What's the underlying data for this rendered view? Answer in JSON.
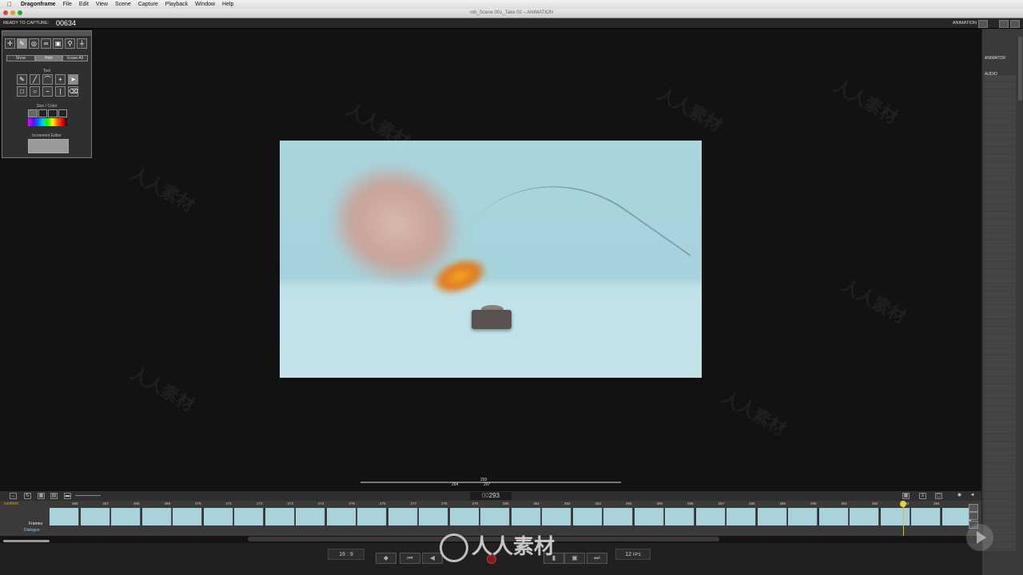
{
  "menubar": {
    "apple": "",
    "app": "Dragonframe",
    "items": [
      "File",
      "Edit",
      "View",
      "Scene",
      "Capture",
      "Playback",
      "Window",
      "Help"
    ]
  },
  "window": {
    "title": "rob_Scene 001_Take 02 – ANIMATION"
  },
  "status": {
    "ready_label": "READY TO CAPTURE:",
    "frame_number": "00634",
    "mode": "ANIMATION"
  },
  "right_panel": {
    "animator": "ANIMATOR",
    "audio": "AUDIO"
  },
  "tool_palette": {
    "segments": [
      "Show",
      "Hide",
      "Erase All"
    ],
    "tool_label": "Tool",
    "size_color_label": "Size / Color",
    "increment_label": "Increment Editor"
  },
  "scrubber": {
    "current": "293",
    "in_point": "264",
    "out_point": "297"
  },
  "timeline": {
    "frame_counter_prefix": "00",
    "frame_counter": "293",
    "conform_label": "conform",
    "tracks": [
      "Frames",
      "Dialogue"
    ],
    "ruler": [
      "266",
      "267",
      "268",
      "269",
      "270",
      "271",
      "272",
      "273",
      "274",
      "275",
      "276",
      "277",
      "278",
      "279",
      "280",
      "281",
      "282",
      "283",
      "284",
      "285",
      "286",
      "287",
      "288",
      "289",
      "290",
      "291",
      "292",
      "293",
      "294"
    ]
  },
  "transport": {
    "aspect": "16 : 9",
    "fps_value": "12",
    "fps_unit": "FPS"
  },
  "watermark": {
    "text": "人人素材"
  },
  "colors": {
    "accent": "#d8c02a",
    "viewer_bg": "#a9d5dd",
    "record": "#7a1f1f"
  }
}
